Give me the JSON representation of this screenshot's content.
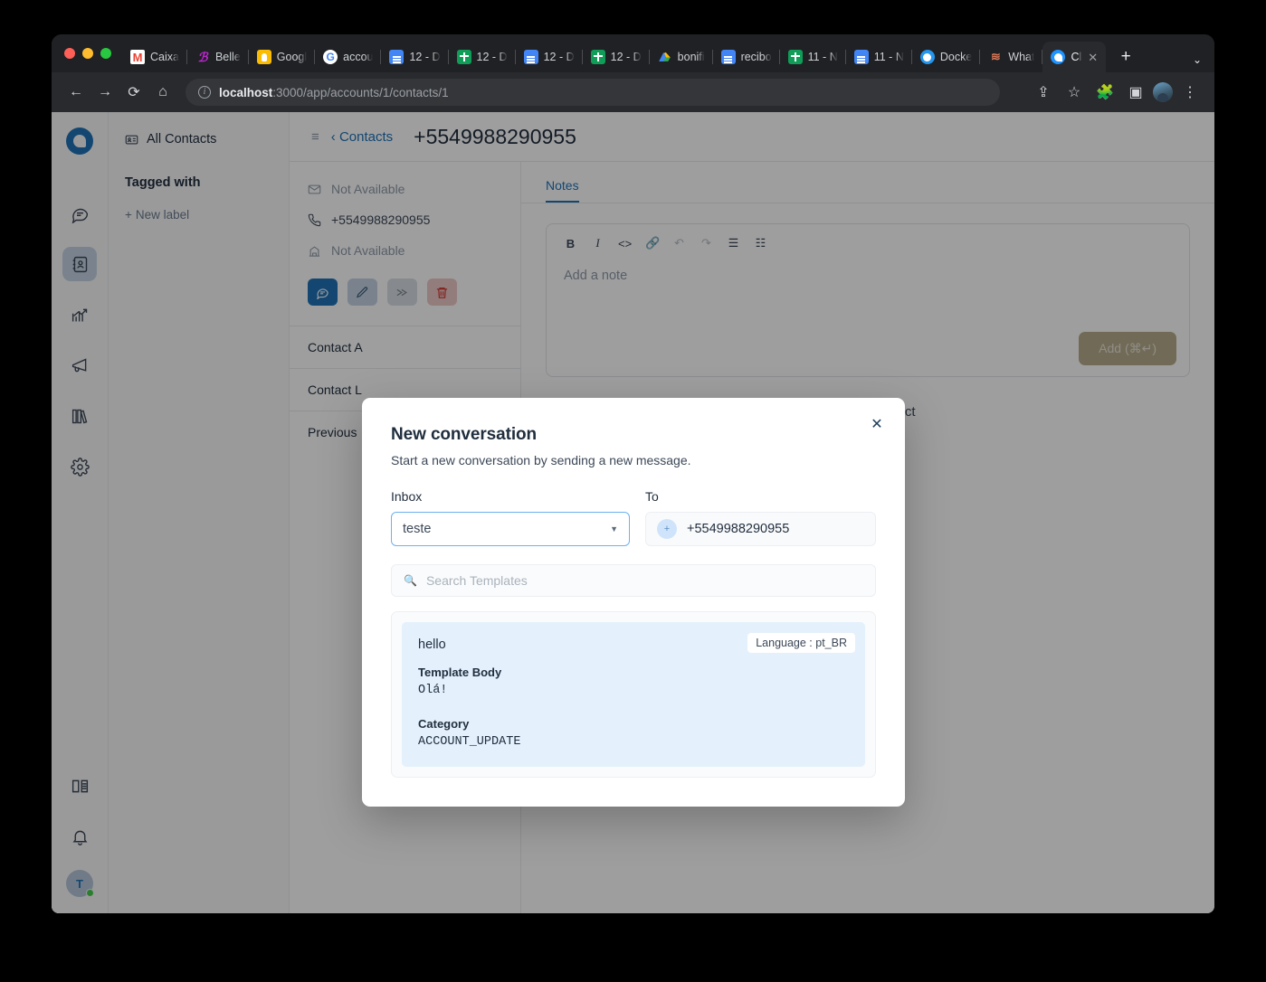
{
  "browser": {
    "tabs": [
      {
        "title": "Caixa",
        "favicon": "gmail-icon",
        "active": false
      },
      {
        "title": "Belle",
        "favicon": "belle-icon",
        "active": false
      },
      {
        "title": "Googl",
        "favicon": "google-keep-icon",
        "active": false
      },
      {
        "title": "accou",
        "favicon": "google-icon",
        "active": false
      },
      {
        "title": "12 - D",
        "favicon": "google-docs-icon",
        "active": false
      },
      {
        "title": "12 - D",
        "favicon": "google-sheets-icon",
        "active": false
      },
      {
        "title": "12 - D",
        "favicon": "google-docs-icon",
        "active": false
      },
      {
        "title": "12 - D",
        "favicon": "google-sheets-icon",
        "active": false
      },
      {
        "title": "bonifi",
        "favicon": "google-drive-icon",
        "active": false
      },
      {
        "title": "recibo",
        "favicon": "google-docs-icon",
        "active": false
      },
      {
        "title": "11 - N",
        "favicon": "google-sheets-icon",
        "active": false
      },
      {
        "title": "11 - N",
        "favicon": "google-docs-icon",
        "active": false
      },
      {
        "title": "Docke",
        "favicon": "docker-icon",
        "active": false
      },
      {
        "title": "What",
        "favicon": "whatsapp-icon",
        "active": false
      },
      {
        "title": "Cl",
        "favicon": "chatwoot-icon",
        "active": true
      }
    ],
    "new_tab_label": "+",
    "url_host": "localhost",
    "url_path": ":3000/app/accounts/1/contacts/1"
  },
  "sidebar": {
    "items": [
      {
        "name": "conversations",
        "icon": "chat-bubble-icon",
        "active": false
      },
      {
        "name": "contacts",
        "icon": "contact-book-icon",
        "active": true
      },
      {
        "name": "reports",
        "icon": "chart-trend-icon",
        "active": false
      },
      {
        "name": "campaigns",
        "icon": "megaphone-icon",
        "active": false
      },
      {
        "name": "help-center",
        "icon": "books-icon",
        "active": false
      },
      {
        "name": "settings",
        "icon": "gear-icon",
        "active": false
      }
    ],
    "bottom_items": [
      {
        "name": "docs",
        "icon": "book-open-icon"
      },
      {
        "name": "notifications",
        "icon": "bell-icon"
      }
    ],
    "avatar_initial": "T"
  },
  "list_pane": {
    "all_contacts": "All Contacts",
    "tagged_with": "Tagged with",
    "new_label": "New label"
  },
  "contact_header": {
    "back_label": "Contacts",
    "title": "+5549988290955"
  },
  "contact_detail": {
    "email": "Not Available",
    "phone": "+5549988290955",
    "company": "Not Available",
    "actions": [
      {
        "name": "new-conversation",
        "icon": "chat-icon"
      },
      {
        "name": "edit-contact",
        "icon": "pencil-icon"
      },
      {
        "name": "merge-contact",
        "icon": "merge-icon"
      },
      {
        "name": "delete-contact",
        "icon": "trash-icon"
      }
    ],
    "accordions": [
      "Contact A",
      "Contact L",
      "Previous "
    ]
  },
  "notes_panel": {
    "tab_label": "Notes",
    "toolbar": [
      "B",
      "I",
      "<>",
      "link",
      "undo",
      "redo",
      "bullet-list",
      "ordered-list"
    ],
    "placeholder": "Add a note",
    "add_button": "Add (⌘↵)",
    "empty_text": "l for this contact"
  },
  "modal": {
    "title": "New conversation",
    "subtitle": "Start a new conversation by sending a new message.",
    "close_label": "✕",
    "inbox_label": "Inbox",
    "inbox_value": "teste",
    "to_label": "To",
    "to_value": "+5549988290955",
    "to_chip": "+",
    "search_placeholder": "Search Templates",
    "template": {
      "name": "hello",
      "language_badge": "Language : pt_BR",
      "body_label": "Template Body",
      "body_value": "Olá!",
      "category_label": "Category",
      "category_value": "ACCOUNT_UPDATE"
    }
  },
  "colors": {
    "accent": "#1f73b7",
    "template_card": "#e4f0fc",
    "focus_border": "#6cb2ef"
  }
}
